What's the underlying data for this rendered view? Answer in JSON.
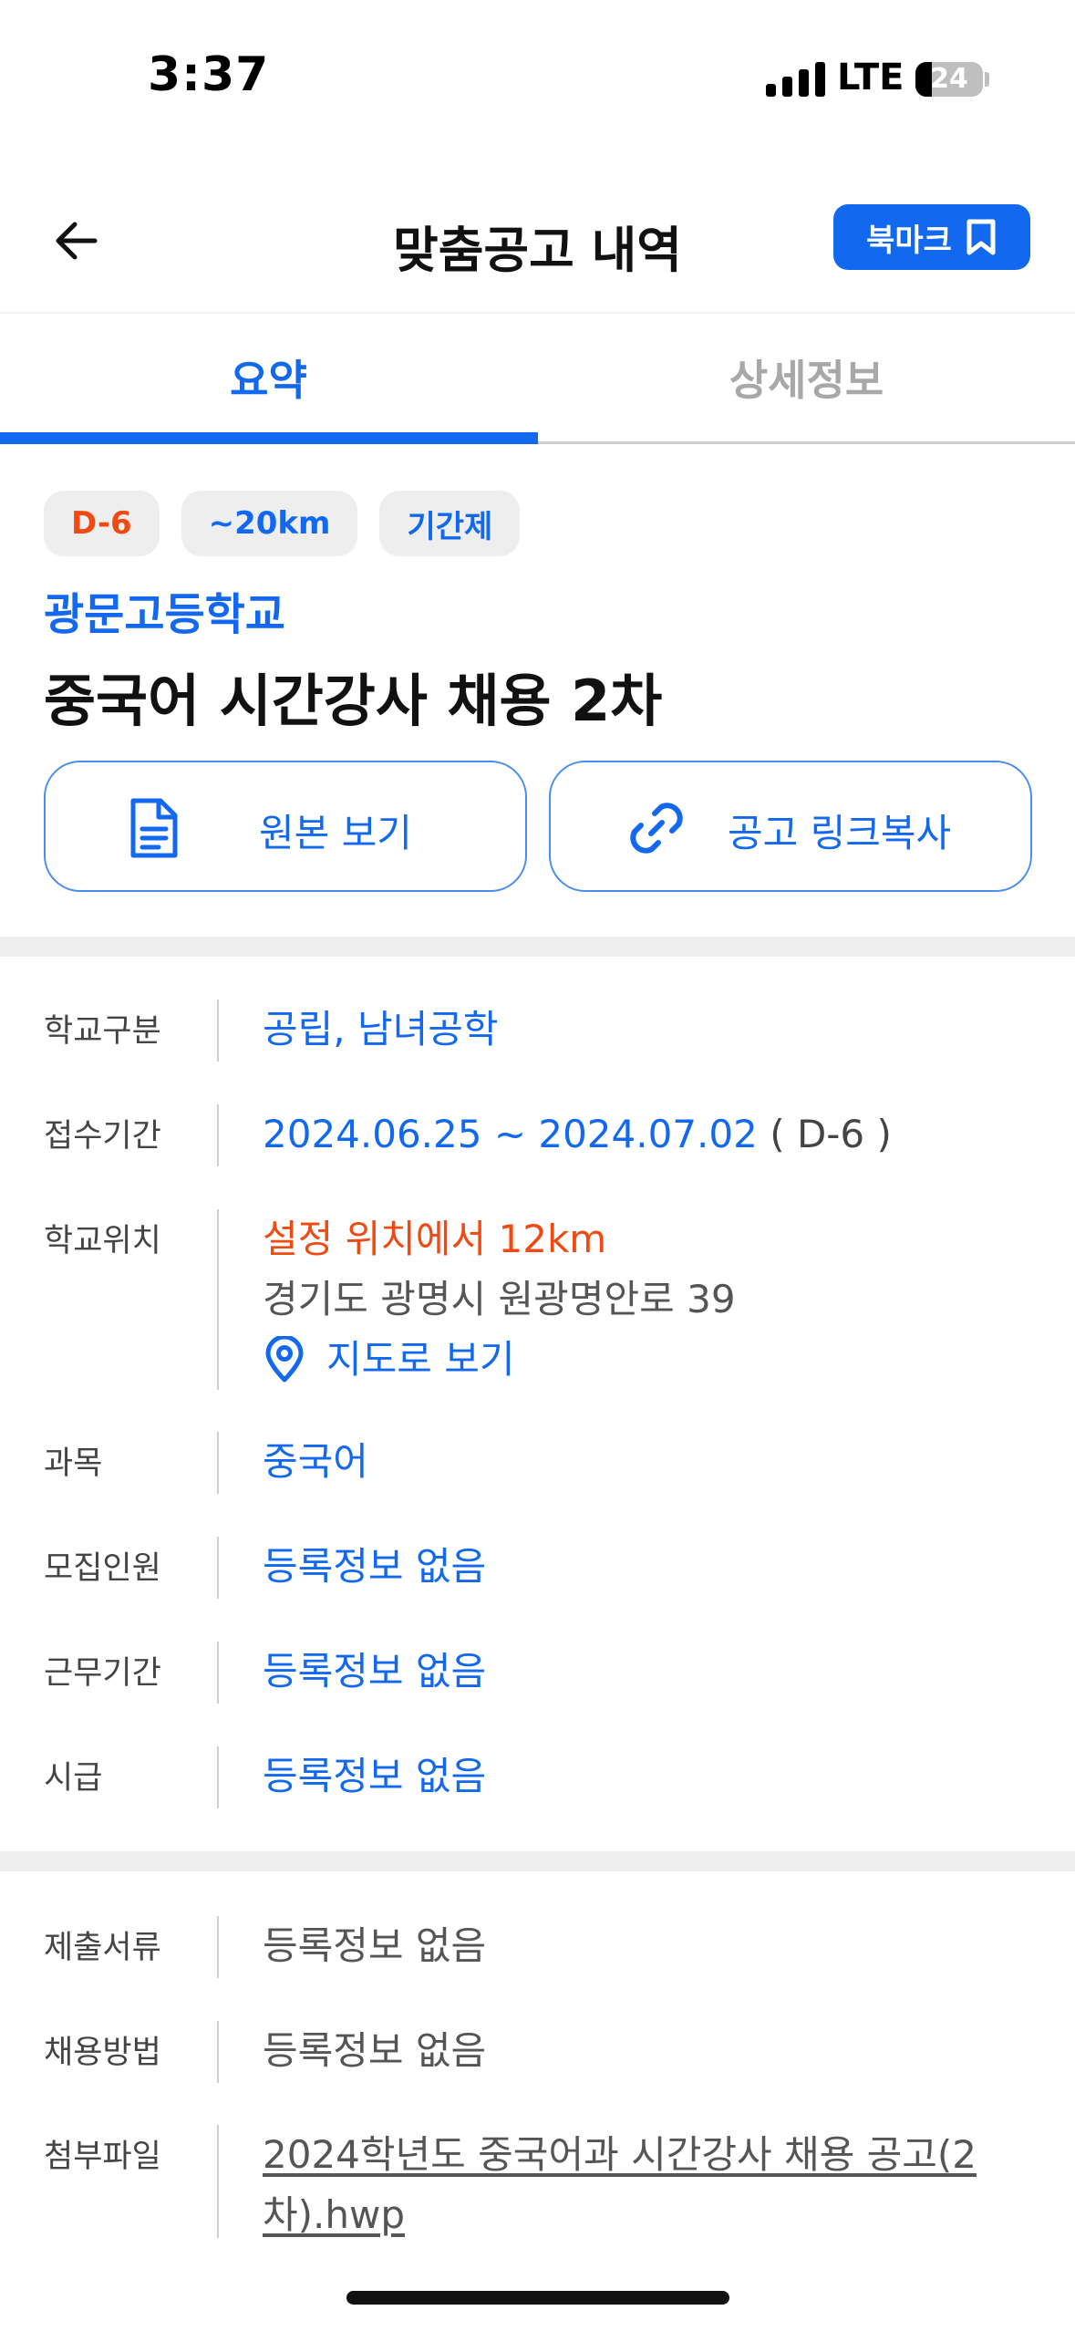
{
  "status_bar": {
    "time": "3:37",
    "network": "LTE",
    "battery_level": "24",
    "battery_fraction": 0.24
  },
  "header": {
    "title": "맞춤공고 내역",
    "back_icon": "arrow-left-icon",
    "bookmark_label": "북마크",
    "bookmark_icon": "bookmark-icon"
  },
  "tabs": [
    {
      "label": "요약",
      "active": true
    },
    {
      "label": "상세정보",
      "active": false
    }
  ],
  "chips": [
    {
      "label": "D-6",
      "color": "#f04a12"
    },
    {
      "label": "~20km",
      "color": "#1269ef"
    },
    {
      "label": "기간제",
      "color": "#1269ef"
    }
  ],
  "school_name": "광문고등학교",
  "job_title": "중국어 시간강사 채용 2차",
  "actions": {
    "original_label": "원본 보기",
    "original_icon": "document-icon",
    "copy_label": "공고 링크복사",
    "copy_icon": "link-icon"
  },
  "info": {
    "school_type": {
      "label": "학교구분",
      "value": "공립, 남녀공학"
    },
    "period": {
      "label": "접수기간",
      "value": "2024.06.25 ~ 2024.07.02",
      "dday": "( D-6 )"
    },
    "location": {
      "label": "학교위치",
      "distance": "설정 위치에서 12km",
      "address": "경기도 광명시 원광명안로 39",
      "map_label": "지도로 보기",
      "map_icon": "location-pin-icon"
    },
    "subject": {
      "label": "과목",
      "value": "중국어"
    },
    "recruit_count": {
      "label": "모집인원",
      "value": "등록정보 없음"
    },
    "work_period": {
      "label": "근무기간",
      "value": "등록정보 없음"
    },
    "hourly_wage": {
      "label": "시급",
      "value": "등록정보 없음"
    }
  },
  "info2": {
    "documents": {
      "label": "제출서류",
      "value": "등록정보 없음"
    },
    "method": {
      "label": "채용방법",
      "value": "등록정보 없음"
    },
    "attachment": {
      "label": "첨부파일",
      "value": "2024학년도 중국어과 시간강사 채용 공고(2차).hwp"
    }
  },
  "colors": {
    "primary": "#1269ef",
    "dday": "#f04a12",
    "chip_bg": "#eeeeee"
  }
}
